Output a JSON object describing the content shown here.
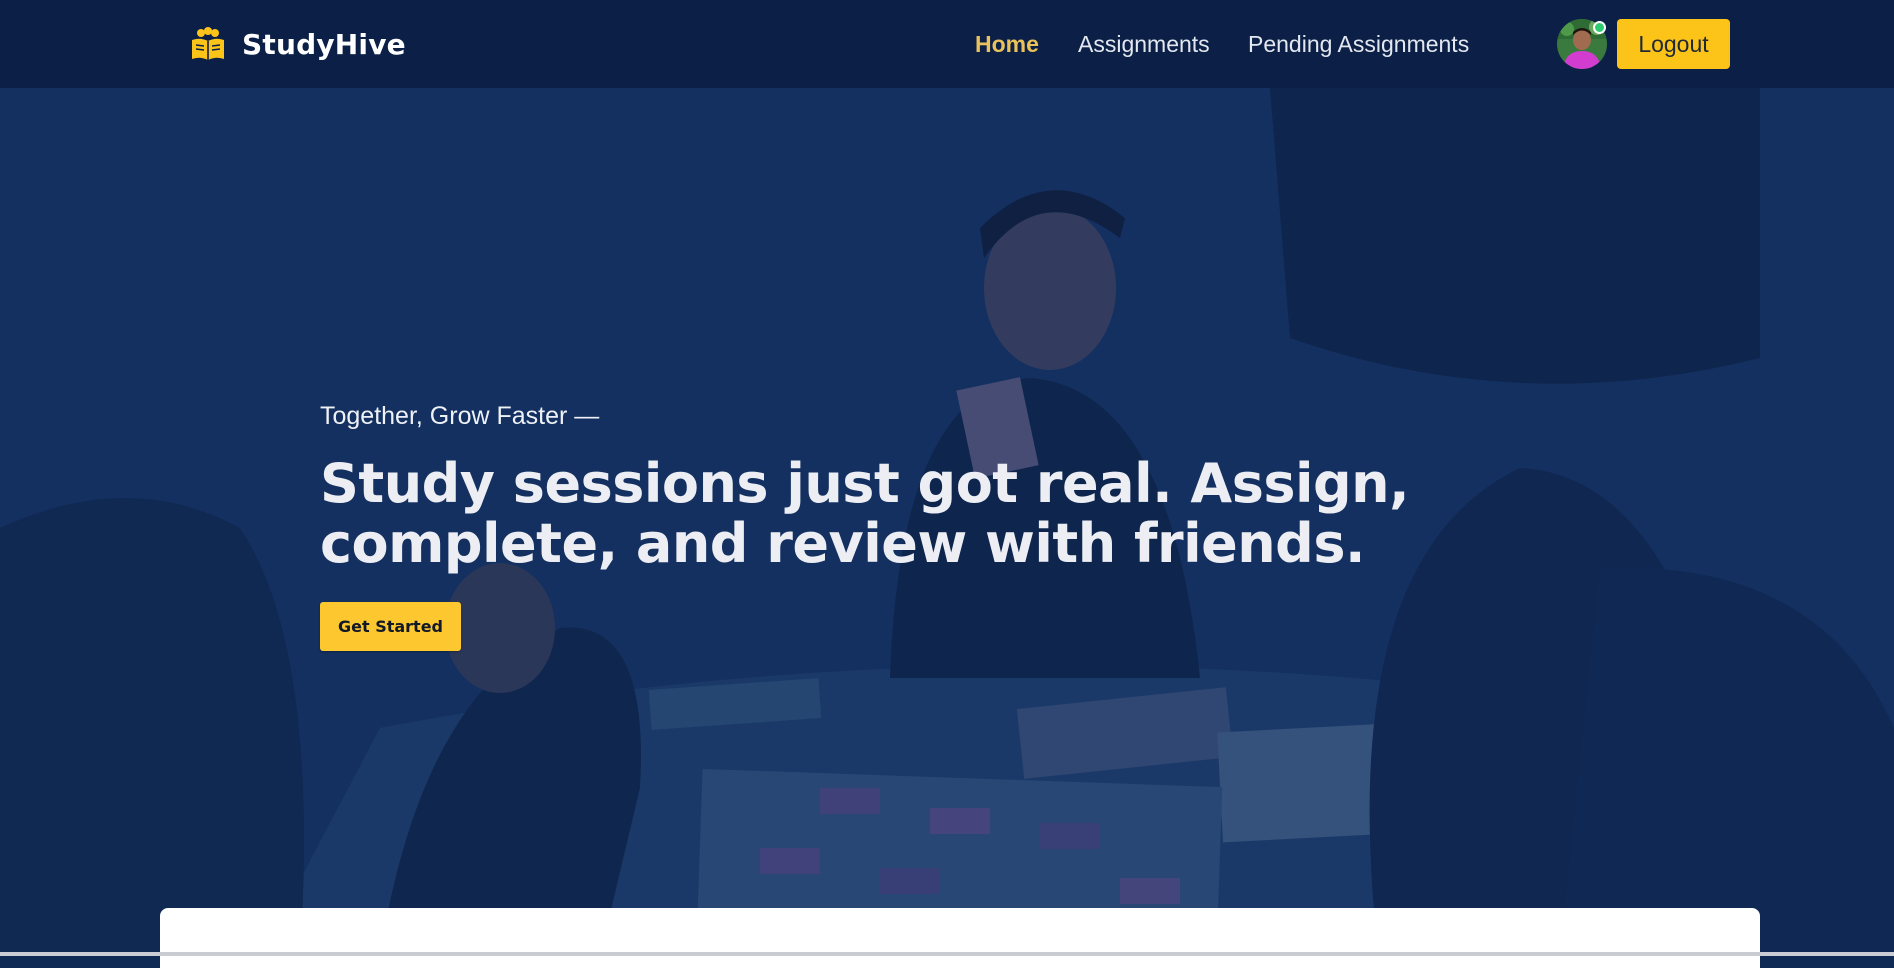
{
  "brand": {
    "name": "StudyHive",
    "icon": "open-book-group-icon"
  },
  "nav": {
    "links": [
      {
        "label": "Home",
        "active": true
      },
      {
        "label": "Assignments",
        "active": false
      },
      {
        "label": "Pending Assignments",
        "active": false
      }
    ],
    "logout_label": "Logout",
    "user_online": true
  },
  "hero": {
    "tagline": "Together, Grow Faster —",
    "headline": "Study sessions just got real. Assign, complete, and review with friends.",
    "cta_label": "Get Started"
  },
  "colors": {
    "navbar_bg": "#0c2047",
    "accent": "#fcc419",
    "active_link": "#e9c25a",
    "hero_overlay": "#0e2858"
  }
}
